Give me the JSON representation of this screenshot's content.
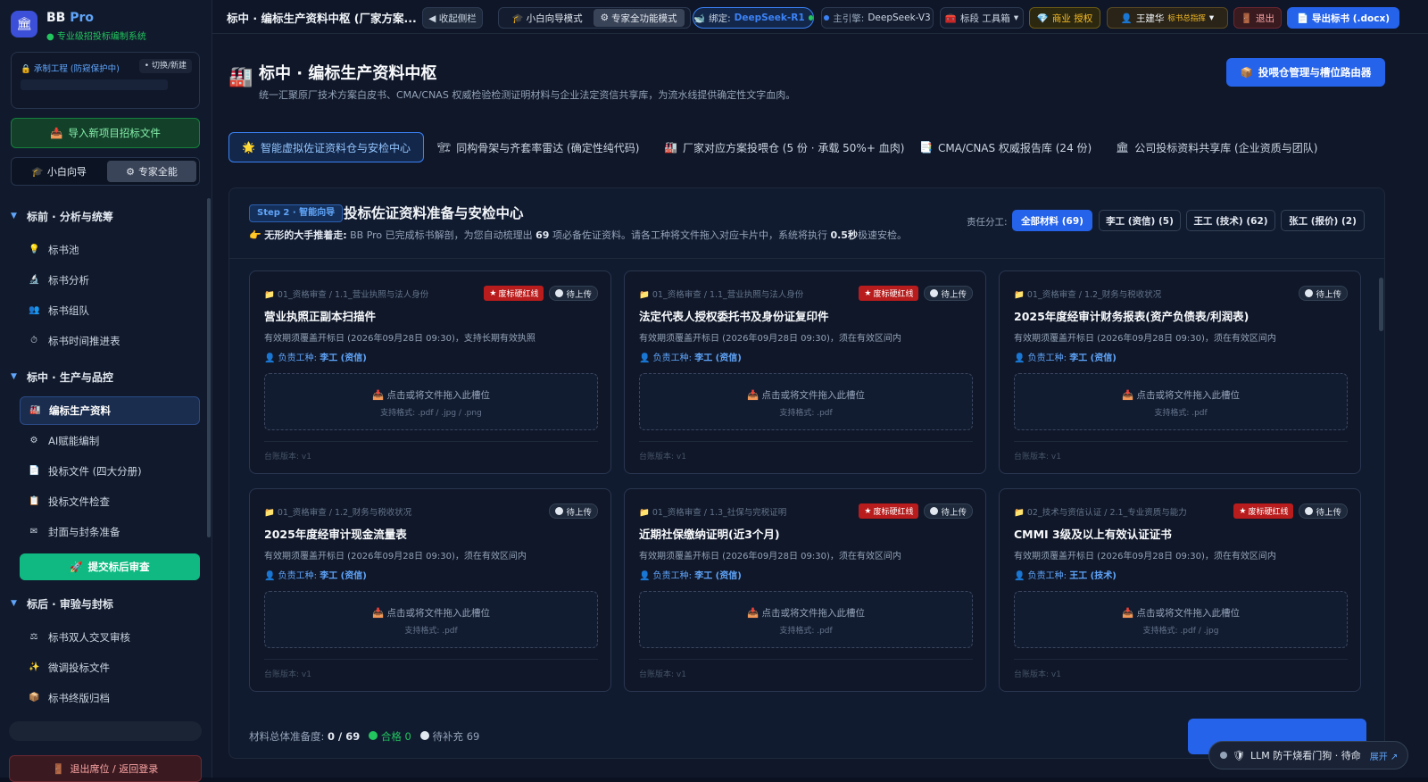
{
  "sidebar": {
    "logo_icon": "bank-icon",
    "brand": "BB",
    "brand_pro": "Pro",
    "brand_sub": "专业级招投标编制系统",
    "project_label": "承制工程 (防窥保护中)",
    "switch_label": "切换/新建",
    "import_label": "导入新项目招标文件",
    "mode_guide": "小白向导",
    "mode_expert": "专家全能",
    "sections": [
      {
        "label": "标前 · 分析与统筹",
        "items": [
          {
            "icon": "💡",
            "label": "标书池"
          },
          {
            "icon": "🔬",
            "label": "标书分析"
          },
          {
            "icon": "👥",
            "label": "标书组队"
          },
          {
            "icon": "⏱",
            "label": "标书时间推进表"
          }
        ]
      },
      {
        "label": "标中 · 生产与品控",
        "items": [
          {
            "icon": "🏭",
            "label": "编标生产资料"
          },
          {
            "icon": "⚙",
            "label": "AI赋能编制"
          },
          {
            "icon": "📄",
            "label": "投标文件 (四大分册)"
          },
          {
            "icon": "📋",
            "label": "投标文件检查"
          },
          {
            "icon": "✉",
            "label": "封面与封条准备"
          }
        ]
      },
      {
        "label": "标后 · 审验与封标",
        "items": [
          {
            "icon": "⚖",
            "label": "标书双人交叉审核"
          },
          {
            "icon": "✨",
            "label": "微调投标文件"
          },
          {
            "icon": "📦",
            "label": "标书终版归档"
          }
        ]
      }
    ],
    "submit_label": "提交标后审查",
    "logout_label": "退出席位 / 返回登录"
  },
  "topbar": {
    "title": "标中 · 编标生产资料中枢 (厂家方案...",
    "collapse_label": "◀ 收起侧栏",
    "mode_guide": "小白向导模式",
    "mode_expert": "专家全功能模式",
    "bind_label": "绑定:",
    "bind_model": "DeepSeek-R1",
    "engine_label": "主引擎:",
    "engine_model": "DeepSeek-V3",
    "toolbox_label": "标段 工具箱",
    "auth_label": "商业 授权",
    "user_name": "王建华",
    "user_role": "标书总指挥",
    "exit_label": "退出",
    "export_label": "导出标书 (.docx)"
  },
  "page": {
    "icon": "factory-icon",
    "title": "标中 · 编标生产资料中枢",
    "subtitle": "统一汇聚原厂技术方案白皮书、CMA/CNAS 权威检验检测证明材料与企业法定资信共享库，为流水线提供确定性文字血肉。",
    "router_button": "投喂仓管理与槽位路由器"
  },
  "tabs": [
    {
      "icon": "🌟",
      "label": "智能虚拟佐证资料仓与安检中心"
    },
    {
      "icon": "🏗",
      "label": "同构骨架与齐套率雷达 (确定性纯代码)"
    },
    {
      "icon": "🏭",
      "label": "厂家对应方案投喂仓 (5 份 · 承载 50%+ 血肉)"
    },
    {
      "icon": "📑",
      "label": "CMA/CNAS 权威报告库 (24 份)"
    },
    {
      "icon": "🏛",
      "label": "公司投标资料共享库 (企业资质与团队)"
    }
  ],
  "panel": {
    "step_badge": "Step 2 · 智能向导",
    "title": "投标佐证资料准备与安检中心",
    "desc_lead": "无形的大手推着走:",
    "desc_a": " BB Pro 已完成标书解剖，为您自动梳理出 ",
    "desc_count": "69",
    "desc_b": " 项必备佐证资料。请各工种将文件拖入对应卡片中，系统将执行 ",
    "desc_speed": "0.5秒",
    "desc_c": "极速安检。",
    "filter_label": "责任分工:",
    "filters": [
      "全部材料 (69)",
      "李工 (资信) (5)",
      "王工 (技术) (62)",
      "张工 (报价) (2)"
    ]
  },
  "card_labels": {
    "red_badge": "废标硬红线",
    "pending_badge": "待上传",
    "owner_prefix": "负责工种:",
    "drop_label": "点击或将文件拖入此槽位",
    "version": "台账版本: v1"
  },
  "cards": [
    {
      "path": "01_资格审查 / 1.1_营业执照与法人身份",
      "red": true,
      "title": "营业执照正副本扫描件",
      "desc": "有效期须覆盖开标日 (2026年09月28日 09:30)，支持长期有效执照",
      "owner": "李工 (资信)",
      "formats": "支持格式: .pdf / .jpg / .png"
    },
    {
      "path": "01_资格审查 / 1.1_营业执照与法人身份",
      "red": true,
      "title": "法定代表人授权委托书及身份证复印件",
      "desc": "有效期须覆盖开标日 (2026年09月28日 09:30)，须在有效区间内",
      "owner": "李工 (资信)",
      "formats": "支持格式: .pdf"
    },
    {
      "path": "01_资格审查 / 1.2_财务与税收状况",
      "red": false,
      "title": "2025年度经审计财务报表(资产负债表/利润表)",
      "desc": "有效期须覆盖开标日 (2026年09月28日 09:30)，须在有效区间内",
      "owner": "李工 (资信)",
      "formats": "支持格式: .pdf"
    },
    {
      "path": "01_资格审查 / 1.2_财务与税收状况",
      "red": false,
      "title": "2025年度经审计现金流量表",
      "desc": "有效期须覆盖开标日 (2026年09月28日 09:30)，须在有效区间内",
      "owner": "李工 (资信)",
      "formats": "支持格式: .pdf"
    },
    {
      "path": "01_资格审查 / 1.3_社保与完税证明",
      "red": true,
      "title": "近期社保缴纳证明(近3个月)",
      "desc": "有效期须覆盖开标日 (2026年09月28日 09:30)，须在有效区间内",
      "owner": "李工 (资信)",
      "formats": "支持格式: .pdf"
    },
    {
      "path": "02_技术与资信认证 / 2.1_专业资质与能力",
      "red": true,
      "title": "CMMI 3级及以上有效认证证书",
      "desc": "有效期须覆盖开标日 (2026年09月28日 09:30)，须在有效区间内",
      "owner": "王工 (技术)",
      "formats": "支持格式: .pdf / .jpg"
    }
  ],
  "footer": {
    "progress_label": "材料总体准备度:",
    "progress_value": "0 / 69",
    "pass_label": "合格 0",
    "pending_label": "待补充 69"
  },
  "watchdog": {
    "label": "LLM 防干烧看门狗 · 待命",
    "expand": "展开 ↗"
  },
  "colors": {
    "accent": "#2563eb",
    "success": "#22c55e",
    "danger": "#b91c1c",
    "warning": "#fbbf24"
  }
}
